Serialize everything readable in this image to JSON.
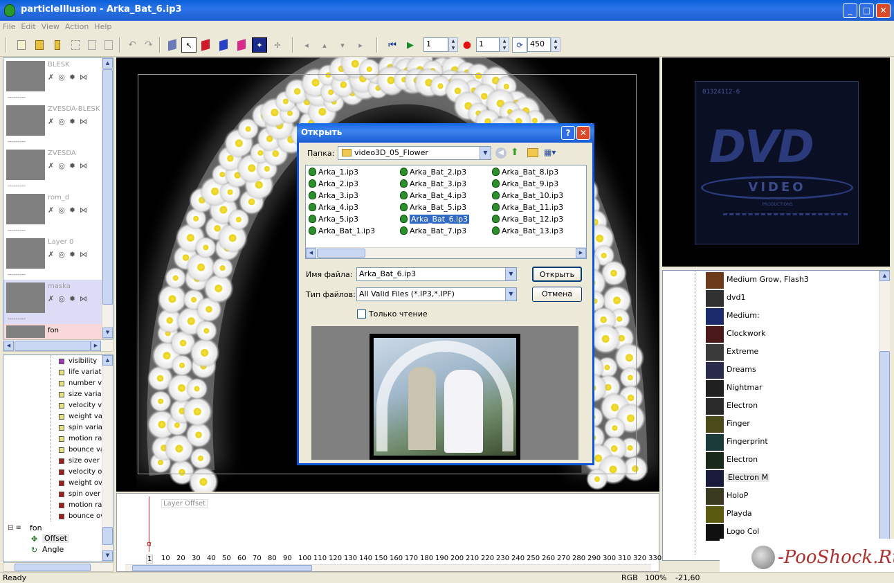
{
  "window": {
    "title": "particleIllusion - Arka_Bat_6.ip3"
  },
  "menu": [
    "File",
    "Edit",
    "View",
    "Action",
    "Help"
  ],
  "toolbar": {
    "frame_current": "1",
    "frame_record": "1",
    "frame_end": "450"
  },
  "layers": [
    {
      "name": "BLESK"
    },
    {
      "name": "ZVESDA-BLESK"
    },
    {
      "name": "ZVESDA"
    },
    {
      "name": "rom_d"
    },
    {
      "name": "Layer 0"
    },
    {
      "name": "maska"
    },
    {
      "name": "fon"
    }
  ],
  "layer_dots": "---------",
  "props": {
    "items": [
      "visibility",
      "life variat",
      "number v",
      "size varia",
      "velocity v",
      "weight va",
      "spin varia",
      "motion ra",
      "bounce va",
      "size over",
      "velocity o",
      "weight ov",
      "spin over",
      "motion ra",
      "bounce ov"
    ],
    "node": "fon",
    "children": [
      "Offset",
      "Angle"
    ]
  },
  "timeline": {
    "label": "Layer Offset",
    "ticks": [
      "1",
      "10",
      "20",
      "30",
      "40",
      "50",
      "60",
      "70",
      "80",
      "90",
      "100",
      "110",
      "120",
      "130",
      "140",
      "150",
      "160",
      "170",
      "180",
      "190",
      "200",
      "210",
      "220",
      "230",
      "240",
      "250",
      "260",
      "270",
      "280",
      "290",
      "300",
      "310",
      "320",
      "330"
    ]
  },
  "dvd": {
    "code": "01324112-6",
    "logo": "DVD",
    "video": "VIDEO",
    "sub": "PRODUCTIONS"
  },
  "presets": [
    "Medium Grow, Flash3",
    "dvd1",
    "Medium:",
    "Clockwork",
    "Extreme",
    "Dreams",
    "Nightmar",
    "Electron",
    "Finger",
    "Fingerprint",
    "Electron",
    "Electron M",
    "HoloP",
    "Playda",
    "Logo Col"
  ],
  "status": {
    "ready": "Ready",
    "mode": "RGB",
    "zoom": "100%",
    "coord": "-21,60"
  },
  "watermark": "PooShock.Ru",
  "dialog": {
    "title": "Открыть",
    "folder_label": "Папка:",
    "folder_value": "video3D_05_Flower",
    "files": [
      [
        "Arka_1.ip3",
        "Arka_2.ip3",
        "Arka_3.ip3",
        "Arka_4.ip3",
        "Arka_5.ip3",
        "Arka_Bat_1.ip3"
      ],
      [
        "Arka_Bat_2.ip3",
        "Arka_Bat_3.ip3",
        "Arka_Bat_4.ip3",
        "Arka_Bat_5.ip3",
        "Arka_Bat_6.ip3",
        "Arka_Bat_7.ip3"
      ],
      [
        "Arka_Bat_8.ip3",
        "Arka_Bat_9.ip3",
        "Arka_Bat_10.ip3",
        "Arka_Bat_11.ip3",
        "Arka_Bat_12.ip3",
        "Arka_Bat_13.ip3"
      ]
    ],
    "filename_label": "Имя файла:",
    "filename_value": "Arka_Bat_6.ip3",
    "filetype_label": "Тип файлов:",
    "filetype_value": "All Valid Files (*.IP3,*.IPF)",
    "readonly_label": "Только чтение",
    "open_button": "Открыть",
    "cancel_button": "Отмена"
  }
}
